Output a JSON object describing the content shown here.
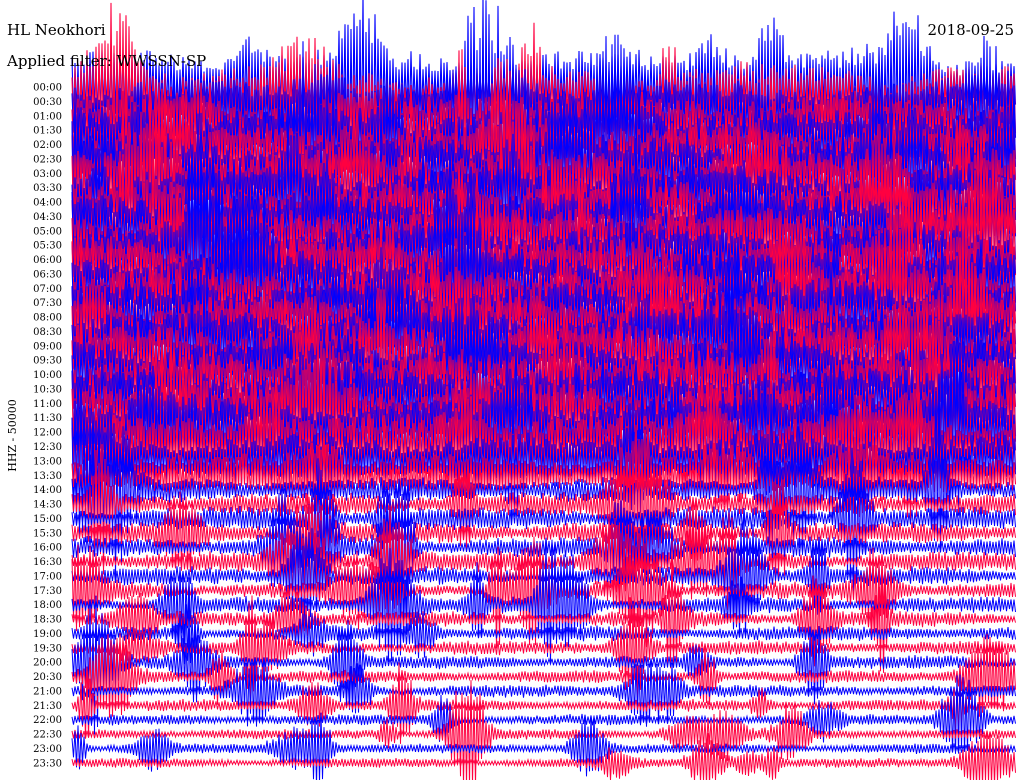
{
  "header": {
    "station": "HL Neokhori",
    "date": "2018-09-25",
    "filter": "Applied filter: WWSSN-SP"
  },
  "channel_label": "HHZ - 50000",
  "colors": {
    "even_trace": "#0000ff",
    "odd_trace": "#ff0040",
    "background": "#ffffff"
  },
  "chart_data": {
    "type": "line",
    "title": "HL Neokhori",
    "subtitle": "Applied filter: WWSSN-SP",
    "ylabel": "HHZ - 50000",
    "xlabel": "",
    "date": "2018-09-25",
    "scale": 50000,
    "tick_labels": [
      "00:00",
      "00:30",
      "01:00",
      "01:30",
      "02:00",
      "02:30",
      "03:00",
      "03:30",
      "04:00",
      "04:30",
      "05:00",
      "05:30",
      "06:00",
      "06:30",
      "07:00",
      "07:30",
      "08:00",
      "08:30",
      "09:00",
      "09:30",
      "10:00",
      "10:30",
      "11:00",
      "11:30",
      "12:00",
      "12:30",
      "13:00",
      "13:30",
      "14:00",
      "14:30",
      "15:00",
      "15:30",
      "16:00",
      "16:30",
      "17:00",
      "17:30",
      "18:00",
      "18:30",
      "19:00",
      "19:30",
      "20:00",
      "20:30",
      "21:00",
      "21:30",
      "22:00",
      "22:30",
      "23:00",
      "23:30"
    ],
    "series_colors": [
      "#0000ff",
      "#ff0040"
    ],
    "grid": false,
    "rows": 48
  }
}
